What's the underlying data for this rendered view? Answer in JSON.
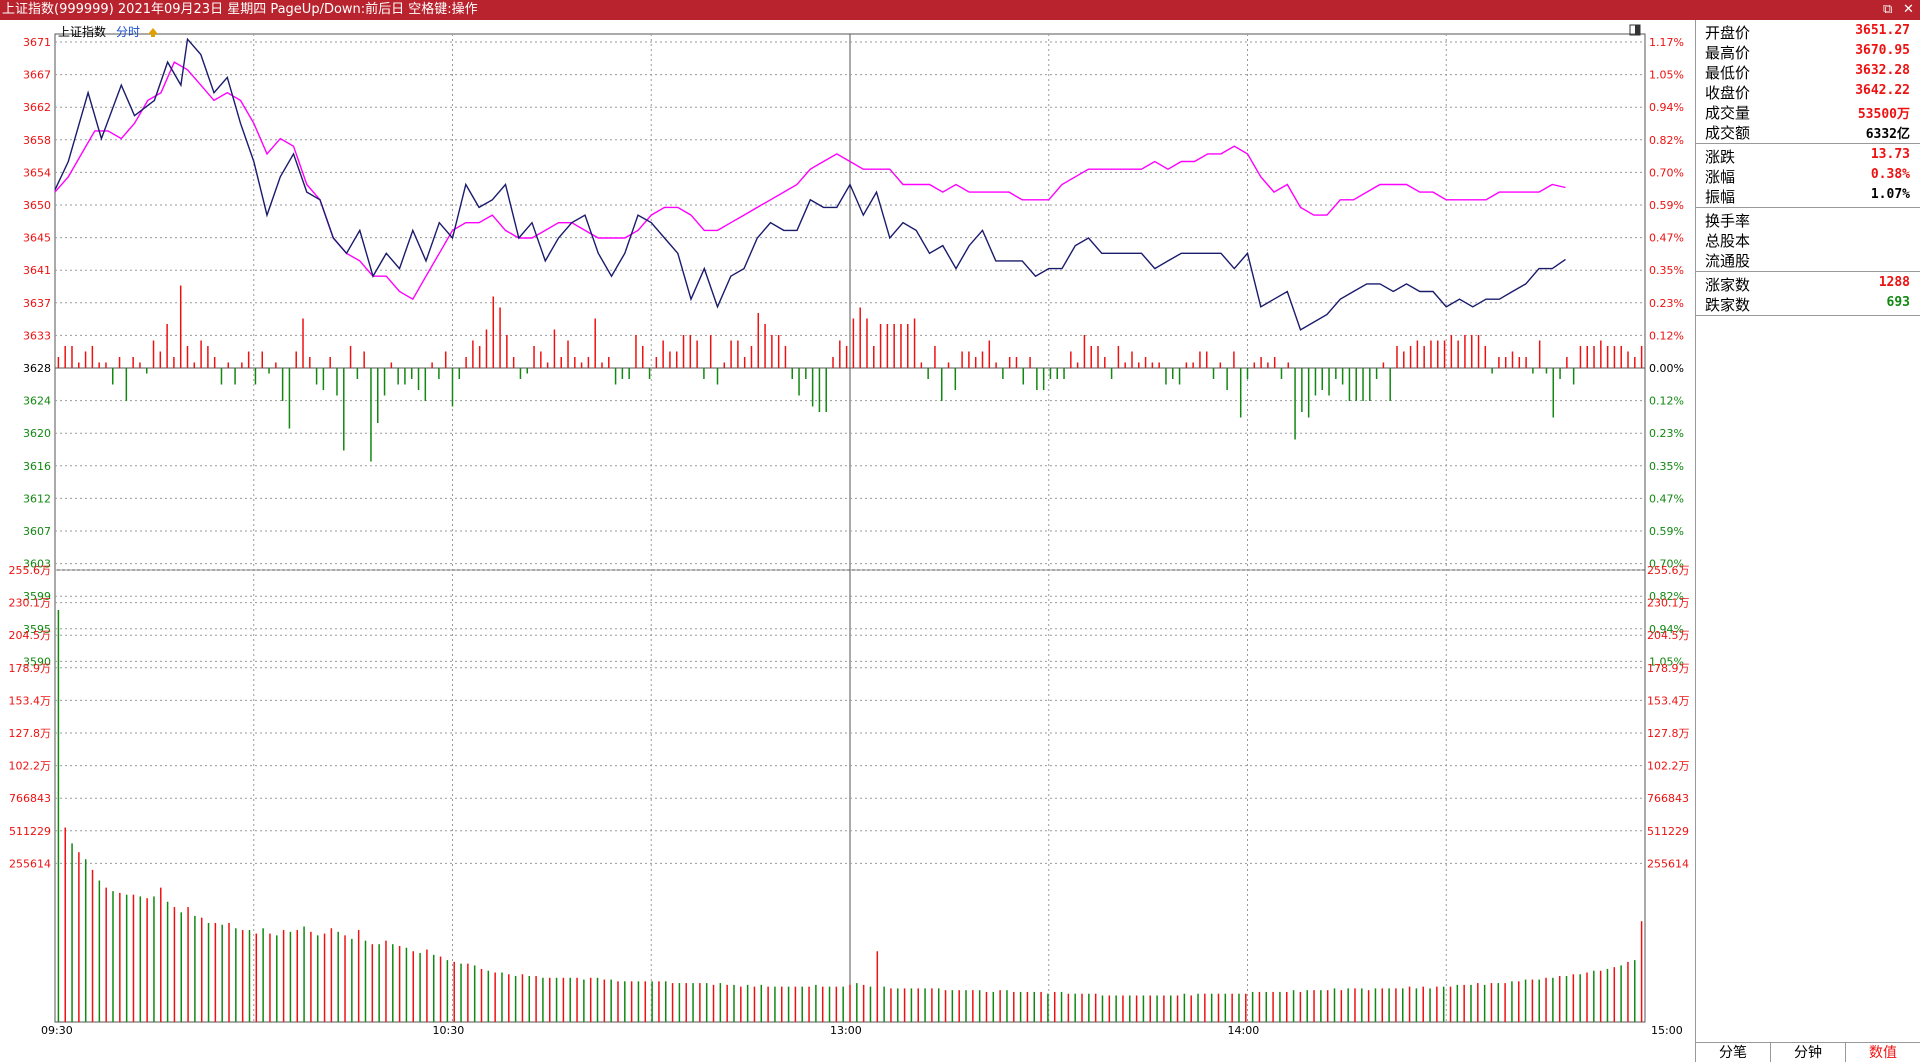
{
  "window": {
    "title": "上证指数(999999) 2021年09月23日 星期四 PageUp/Down:前后日 空格键:操作"
  },
  "chart_header": {
    "name": "上证指数",
    "mode": "分时",
    "arrow": "up-arrow-icon"
  },
  "colors": {
    "price_line": "#1b1b6e",
    "avg_line": "#ff00ff",
    "up": "#ee1111",
    "down": "#118811",
    "grid": "#9a9a9a",
    "title_bg": "#b8232e"
  },
  "info_panel": {
    "stats": [
      {
        "label": "开盘价",
        "value": "3651.27",
        "color": "#ee1111"
      },
      {
        "label": "最高价",
        "value": "3670.95",
        "color": "#ee1111"
      },
      {
        "label": "最低价",
        "value": "3632.28",
        "color": "#ee1111"
      },
      {
        "label": "收盘价",
        "value": "3642.22",
        "color": "#ee1111"
      },
      {
        "label": "成交量",
        "value": "53500万",
        "color": "#ee1111"
      },
      {
        "label": "成交额",
        "value": "6332亿",
        "color": "#000000"
      }
    ],
    "change": [
      {
        "label": "涨跌",
        "value": "13.73",
        "color": "#ee1111"
      },
      {
        "label": "涨幅",
        "value": "0.38%",
        "color": "#ee1111"
      },
      {
        "label": "振幅",
        "value": "1.07%",
        "color": "#000000"
      }
    ],
    "share": [
      {
        "label": "换手率",
        "value": ""
      },
      {
        "label": "总股本",
        "value": ""
      },
      {
        "label": "流通股",
        "value": ""
      }
    ],
    "breadth": [
      {
        "label": "涨家数",
        "value": "1288",
        "color": "#ee1111"
      },
      {
        "label": "跌家数",
        "value": "693",
        "color": "#118811"
      }
    ],
    "tabs": [
      "分笔",
      "分钟",
      "数值"
    ]
  },
  "chart_data": {
    "type": "line",
    "price_axis": {
      "ticks": [
        "3671",
        "3667",
        "3662",
        "3658",
        "3654",
        "3650",
        "3645",
        "3641",
        "3637",
        "3633",
        "3628",
        "3624",
        "3620",
        "3616",
        "3612",
        "3607",
        "3603",
        "3599",
        "3595",
        "3590"
      ],
      "pct_ticks": [
        "1.17%",
        "1.05%",
        "0.94%",
        "0.82%",
        "0.70%",
        "0.59%",
        "0.47%",
        "0.35%",
        "0.23%",
        "0.12%",
        "0.00%",
        "0.12%",
        "0.23%",
        "0.35%",
        "0.47%",
        "0.59%",
        "0.70%",
        "0.82%",
        "0.94%",
        "1.05%"
      ],
      "range": [
        3586,
        3671
      ],
      "base": 3628
    },
    "volume_axis": {
      "ticks": [
        "255.6万",
        "230.1万",
        "204.5万",
        "178.9万",
        "153.4万",
        "127.8万",
        "102.2万",
        "766843",
        "511229",
        "255614"
      ],
      "right_ticks": [
        "255.6万",
        "230.1万",
        "204.5万",
        "178.9万",
        "153.4万",
        "127.8万",
        "102.2万",
        "766843",
        "511229",
        "255614"
      ],
      "max": 2556000
    },
    "x_labels": [
      "09:30",
      "10:30",
      "13:00",
      "14:00",
      "15:00"
    ],
    "price_points": [
      [
        0,
        3651.3
      ],
      [
        2,
        3655
      ],
      [
        5,
        3664
      ],
      [
        7,
        3658
      ],
      [
        10,
        3665
      ],
      [
        12,
        3661
      ],
      [
        15,
        3663
      ],
      [
        17,
        3668
      ],
      [
        19,
        3665
      ],
      [
        20,
        3671
      ],
      [
        22,
        3669
      ],
      [
        24,
        3664
      ],
      [
        26,
        3666
      ],
      [
        28,
        3660
      ],
      [
        30,
        3655
      ],
      [
        32,
        3648
      ],
      [
        34,
        3653
      ],
      [
        36,
        3656
      ],
      [
        38,
        3651
      ],
      [
        40,
        3650
      ],
      [
        42,
        3645
      ],
      [
        44,
        3643
      ],
      [
        46,
        3646
      ],
      [
        48,
        3640
      ],
      [
        50,
        3643
      ],
      [
        52,
        3641
      ],
      [
        54,
        3646
      ],
      [
        56,
        3642
      ],
      [
        58,
        3647
      ],
      [
        60,
        3645
      ],
      [
        62,
        3652
      ],
      [
        64,
        3649
      ],
      [
        66,
        3650
      ],
      [
        68,
        3652
      ],
      [
        70,
        3645
      ],
      [
        72,
        3647
      ],
      [
        74,
        3642
      ],
      [
        76,
        3645
      ],
      [
        78,
        3647
      ],
      [
        80,
        3648
      ],
      [
        82,
        3643
      ],
      [
        84,
        3640
      ],
      [
        86,
        3643
      ],
      [
        88,
        3648
      ],
      [
        90,
        3647
      ],
      [
        92,
        3645
      ],
      [
        94,
        3643
      ],
      [
        96,
        3637
      ],
      [
        98,
        3641
      ],
      [
        100,
        3636
      ],
      [
        102,
        3640
      ],
      [
        104,
        3641
      ],
      [
        106,
        3645
      ],
      [
        108,
        3647
      ],
      [
        110,
        3646
      ],
      [
        112,
        3646
      ],
      [
        114,
        3650
      ],
      [
        116,
        3649
      ],
      [
        118,
        3649
      ],
      [
        120,
        3652
      ],
      [
        122,
        3648
      ],
      [
        124,
        3651
      ],
      [
        126,
        3645
      ],
      [
        128,
        3647
      ],
      [
        130,
        3646
      ],
      [
        132,
        3643
      ],
      [
        134,
        3644
      ],
      [
        136,
        3641
      ],
      [
        138,
        3644
      ],
      [
        140,
        3646
      ],
      [
        142,
        3642
      ],
      [
        144,
        3642
      ],
      [
        146,
        3642
      ],
      [
        148,
        3640
      ],
      [
        150,
        3641
      ],
      [
        152,
        3641
      ],
      [
        154,
        3644
      ],
      [
        156,
        3645
      ],
      [
        158,
        3643
      ],
      [
        160,
        3643
      ],
      [
        162,
        3643
      ],
      [
        164,
        3643
      ],
      [
        166,
        3641
      ],
      [
        168,
        3642
      ],
      [
        170,
        3643
      ],
      [
        172,
        3643
      ],
      [
        174,
        3643
      ],
      [
        176,
        3643
      ],
      [
        178,
        3641
      ],
      [
        180,
        3643
      ],
      [
        182,
        3636
      ],
      [
        184,
        3637
      ],
      [
        186,
        3638
      ],
      [
        188,
        3633
      ],
      [
        190,
        3634
      ],
      [
        192,
        3635
      ],
      [
        194,
        3637
      ],
      [
        196,
        3638
      ],
      [
        198,
        3639
      ],
      [
        200,
        3639
      ],
      [
        202,
        3638
      ],
      [
        204,
        3639
      ],
      [
        206,
        3638
      ],
      [
        208,
        3638
      ],
      [
        210,
        3636
      ],
      [
        212,
        3637
      ],
      [
        214,
        3636
      ],
      [
        216,
        3637
      ],
      [
        218,
        3637
      ],
      [
        220,
        3638
      ],
      [
        222,
        3639
      ],
      [
        224,
        3641
      ],
      [
        226,
        3641
      ],
      [
        228,
        3642.2
      ]
    ],
    "avg_points": [
      [
        0,
        3651
      ],
      [
        2,
        3653
      ],
      [
        4,
        3656
      ],
      [
        6,
        3659
      ],
      [
        8,
        3659
      ],
      [
        10,
        3658
      ],
      [
        12,
        3660
      ],
      [
        14,
        3663
      ],
      [
        16,
        3664
      ],
      [
        18,
        3668
      ],
      [
        20,
        3667
      ],
      [
        22,
        3665
      ],
      [
        24,
        3663
      ],
      [
        26,
        3664
      ],
      [
        28,
        3663
      ],
      [
        30,
        3660
      ],
      [
        32,
        3656
      ],
      [
        34,
        3658
      ],
      [
        36,
        3657
      ],
      [
        38,
        3652
      ],
      [
        40,
        3650
      ],
      [
        42,
        3645
      ],
      [
        44,
        3643
      ],
      [
        46,
        3642
      ],
      [
        48,
        3640
      ],
      [
        50,
        3640
      ],
      [
        52,
        3638
      ],
      [
        54,
        3637
      ],
      [
        56,
        3640
      ],
      [
        58,
        3643
      ],
      [
        60,
        3646
      ],
      [
        62,
        3647
      ],
      [
        64,
        3647
      ],
      [
        66,
        3648
      ],
      [
        68,
        3646
      ],
      [
        70,
        3645
      ],
      [
        72,
        3645
      ],
      [
        74,
        3646
      ],
      [
        76,
        3647
      ],
      [
        78,
        3647
      ],
      [
        80,
        3646
      ],
      [
        82,
        3645
      ],
      [
        84,
        3645
      ],
      [
        86,
        3645
      ],
      [
        88,
        3646
      ],
      [
        90,
        3648
      ],
      [
        92,
        3649
      ],
      [
        94,
        3649
      ],
      [
        96,
        3648
      ],
      [
        98,
        3646
      ],
      [
        100,
        3646
      ],
      [
        102,
        3647
      ],
      [
        104,
        3648
      ],
      [
        106,
        3649
      ],
      [
        108,
        3650
      ],
      [
        110,
        3651
      ],
      [
        112,
        3652
      ],
      [
        114,
        3654
      ],
      [
        116,
        3655
      ],
      [
        118,
        3656
      ],
      [
        120,
        3655
      ],
      [
        122,
        3654
      ],
      [
        124,
        3654
      ],
      [
        126,
        3654
      ],
      [
        128,
        3652
      ],
      [
        130,
        3652
      ],
      [
        132,
        3652
      ],
      [
        134,
        3651
      ],
      [
        136,
        3652
      ],
      [
        138,
        3651
      ],
      [
        140,
        3651
      ],
      [
        142,
        3651
      ],
      [
        144,
        3651
      ],
      [
        146,
        3650
      ],
      [
        148,
        3650
      ],
      [
        150,
        3650
      ],
      [
        152,
        3652
      ],
      [
        154,
        3653
      ],
      [
        156,
        3654
      ],
      [
        158,
        3654
      ],
      [
        160,
        3654
      ],
      [
        162,
        3654
      ],
      [
        164,
        3654
      ],
      [
        166,
        3655
      ],
      [
        168,
        3654
      ],
      [
        170,
        3655
      ],
      [
        172,
        3655
      ],
      [
        174,
        3656
      ],
      [
        176,
        3656
      ],
      [
        178,
        3657
      ],
      [
        180,
        3656
      ],
      [
        182,
        3653
      ],
      [
        184,
        3651
      ],
      [
        186,
        3652
      ],
      [
        188,
        3649
      ],
      [
        190,
        3648
      ],
      [
        192,
        3648
      ],
      [
        194,
        3650
      ],
      [
        196,
        3650
      ],
      [
        198,
        3651
      ],
      [
        200,
        3652
      ],
      [
        202,
        3652
      ],
      [
        204,
        3652
      ],
      [
        206,
        3651
      ],
      [
        208,
        3651
      ],
      [
        210,
        3650
      ],
      [
        212,
        3650
      ],
      [
        214,
        3650
      ],
      [
        216,
        3650
      ],
      [
        218,
        3651
      ],
      [
        220,
        3651
      ],
      [
        222,
        3651
      ],
      [
        224,
        3651
      ],
      [
        226,
        3652
      ],
      [
        228,
        3651.6
      ]
    ],
    "breadth_bars": [
      2,
      4,
      4,
      1,
      3,
      4,
      1,
      1,
      -3,
      2,
      -6,
      2,
      1,
      -1,
      5,
      3,
      8,
      2,
      15,
      4,
      1,
      5,
      4,
      2,
      -3,
      1,
      -3,
      1,
      3,
      -3,
      3,
      -1,
      1,
      -6,
      -11,
      3,
      9,
      2,
      -3,
      -4,
      2,
      -5,
      -15,
      4,
      -2,
      3,
      -17,
      -10,
      -5,
      1,
      -3,
      -3,
      -2,
      -4,
      -6,
      1,
      -2,
      3,
      -7,
      -2,
      2,
      5,
      4,
      7,
      13,
      11,
      6,
      2,
      -2,
      -1,
      4,
      3,
      1,
      7,
      2,
      5,
      2,
      1,
      2,
      9,
      1,
      2,
      -3,
      -2,
      -2,
      6,
      4,
      -2,
      2,
      5,
      3,
      3,
      6,
      6,
      5,
      -2,
      6,
      -3,
      1,
      5,
      5,
      2,
      4,
      10,
      8,
      6,
      6,
      4,
      -2,
      -5,
      -2,
      -7,
      -8,
      -8,
      2,
      5,
      4,
      9,
      11,
      9,
      4,
      8,
      8,
      8,
      8,
      8,
      9,
      1,
      -2,
      4,
      -6,
      1,
      -4,
      3,
      3,
      2,
      3,
      5,
      1,
      -2,
      2,
      2,
      -3,
      2,
      -4,
      -4,
      -2,
      -2,
      -2,
      3,
      1,
      6,
      4,
      4,
      2,
      -2,
      4,
      1,
      3,
      1,
      2,
      1,
      1,
      -3,
      -2,
      -3,
      1,
      1,
      3,
      3,
      -2,
      1,
      -4,
      3,
      -9,
      -2,
      1,
      2,
      1,
      2,
      -2,
      1,
      -13,
      -8,
      -9,
      -5,
      -4,
      -5,
      -2,
      -3,
      -6,
      -6,
      -6,
      -6,
      -2,
      1,
      -6,
      4,
      3,
      4,
      5,
      4,
      5,
      5,
      5,
      6,
      5,
      6,
      6,
      6,
      4,
      -1,
      2,
      2,
      3,
      2,
      2,
      -1,
      5,
      -1,
      -9,
      -2,
      2,
      -3,
      4,
      4,
      4,
      5,
      4,
      4,
      4,
      3,
      2,
      4
    ],
    "volume": [
      2330000,
      1100000,
      1010000,
      960000,
      920000,
      860000,
      800000,
      760000,
      740000,
      730000,
      720000,
      720000,
      710000,
      700000,
      710000,
      760000,
      680000,
      650000,
      620000,
      650000,
      600000,
      590000,
      560000,
      560000,
      550000,
      560000,
      530000,
      520000,
      520000,
      500000,
      530000,
      500000,
      490000,
      520000,
      510000,
      520000,
      540000,
      510000,
      490000,
      500000,
      530000,
      510000,
      490000,
      470000,
      520000,
      460000,
      440000,
      440000,
      460000,
      440000,
      430000,
      420000,
      400000,
      390000,
      410000,
      380000,
      370000,
      350000,
      340000,
      330000,
      330000,
      320000,
      300000,
      290000,
      280000,
      280000,
      270000,
      260000,
      270000,
      260000,
      260000,
      250000,
      250000,
      250000,
      250000,
      250000,
      250000,
      240000,
      250000,
      250000,
      240000,
      240000,
      230000,
      230000,
      230000,
      230000,
      230000,
      230000,
      230000,
      230000,
      220000,
      220000,
      220000,
      220000,
      220000,
      220000,
      210000,
      220000,
      210000,
      210000,
      200000,
      210000,
      200000,
      210000,
      200000,
      200000,
      200000,
      200000,
      200000,
      200000,
      200000,
      210000,
      200000,
      200000,
      200000,
      200000,
      210000,
      220000,
      210000,
      200000,
      400000,
      200000,
      190000,
      190000,
      190000,
      190000,
      190000,
      190000,
      190000,
      190000,
      180000,
      180000,
      180000,
      180000,
      180000,
      180000,
      170000,
      170000,
      180000,
      180000,
      170000,
      170000,
      170000,
      170000,
      170000,
      160000,
      170000,
      170000,
      160000,
      160000,
      160000,
      160000,
      160000,
      150000,
      150000,
      150000,
      150000,
      150000,
      150000,
      150000,
      150000,
      150000,
      150000,
      150000,
      150000,
      160000,
      150000,
      160000,
      160000,
      160000,
      160000,
      160000,
      160000,
      160000,
      160000,
      170000,
      170000,
      170000,
      170000,
      170000,
      170000,
      180000,
      170000,
      180000,
      180000,
      180000,
      180000,
      190000,
      180000,
      190000,
      190000,
      190000,
      180000,
      190000,
      190000,
      190000,
      190000,
      190000,
      200000,
      190000,
      200000,
      190000,
      200000,
      200000,
      200000,
      210000,
      210000,
      210000,
      220000,
      210000,
      220000,
      220000,
      220000,
      230000,
      230000,
      240000,
      240000,
      240000,
      250000,
      250000,
      260000,
      260000,
      270000,
      270000,
      280000,
      290000,
      290000,
      300000,
      310000,
      320000,
      340000,
      350000,
      570000
    ]
  }
}
